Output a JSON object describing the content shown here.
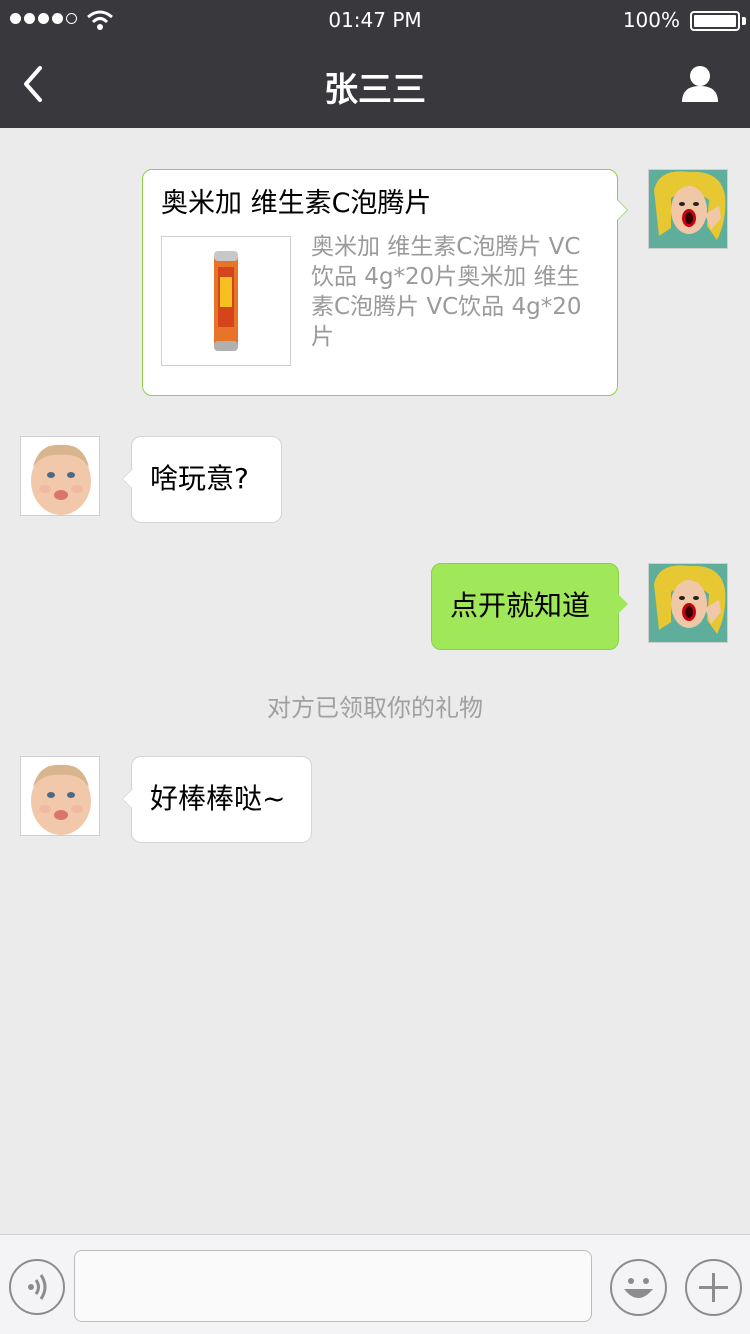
{
  "status_bar": {
    "time": "01:47 PM",
    "battery": "100%"
  },
  "nav": {
    "title": "张三三",
    "back_icon": "chevron-left-icon",
    "profile_icon": "person-icon"
  },
  "messages": [
    {
      "type": "card",
      "side": "right",
      "title": "奥米加 维生素C泡腾片",
      "description": "奥米加 维生素C泡腾片 VC饮品 4g*20片奥米加 维生素C泡腾片 VC饮品 4g*20片"
    },
    {
      "type": "text",
      "side": "left",
      "text": "啥玩意?"
    },
    {
      "type": "text",
      "side": "right",
      "text": "点开就知道"
    },
    {
      "type": "system",
      "text": "对方已领取你的礼物"
    },
    {
      "type": "text",
      "side": "left",
      "text": "好棒棒哒~"
    }
  ],
  "input_bar": {
    "voice_icon": "voice-icon",
    "emoji_icon": "smiley-icon",
    "plus_icon": "plus-icon",
    "placeholder": ""
  },
  "colors": {
    "header": "#39393d",
    "background": "#ebebeb",
    "outgoing_bubble": "#a0e75a"
  }
}
